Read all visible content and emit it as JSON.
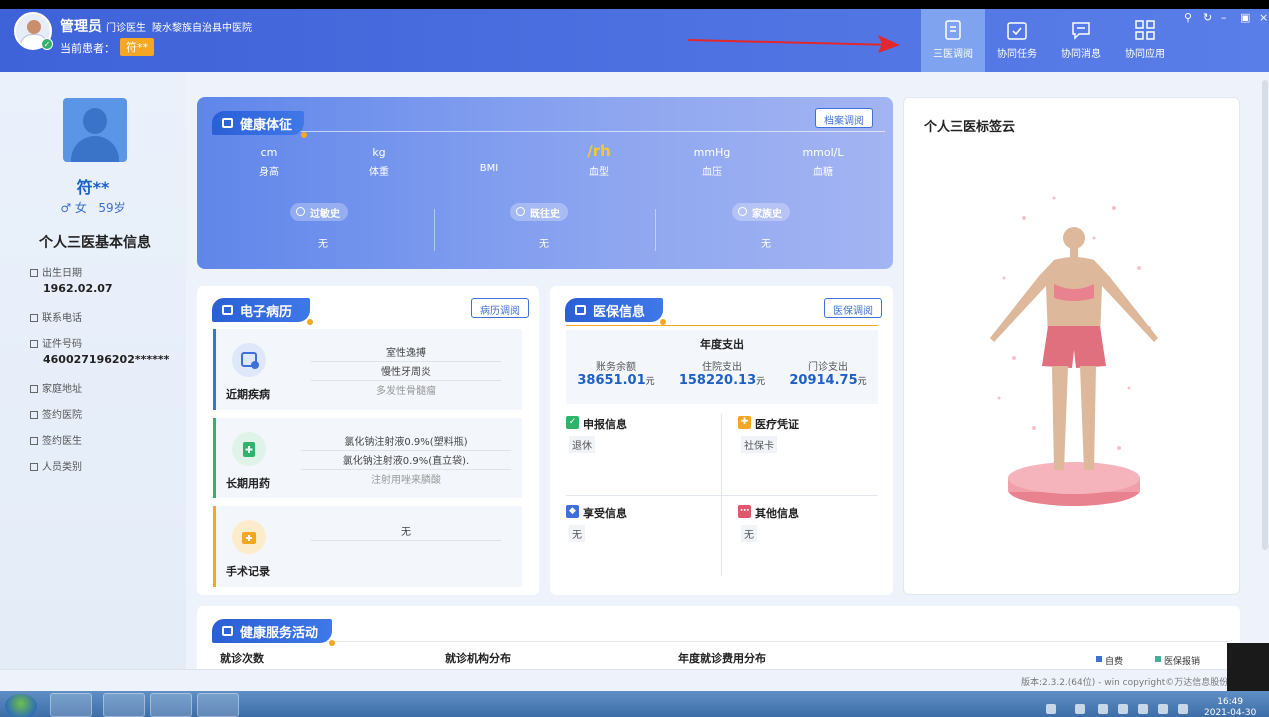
{
  "header": {
    "user_name": "管理员",
    "user_role": "门诊医生",
    "hospital": "陵水黎族自治县中医院",
    "current_patient_label": "当前患者：",
    "current_patient_name": "符**",
    "nav": [
      {
        "label": "三医调阅",
        "icon": "document-icon",
        "active": true
      },
      {
        "label": "协同任务",
        "icon": "calendar-check-icon",
        "active": false
      },
      {
        "label": "协同消息",
        "icon": "chat-icon",
        "active": false
      },
      {
        "label": "协同应用",
        "icon": "apps-grid-icon",
        "active": false
      }
    ],
    "accent_color": "#4a6fe0"
  },
  "patient": {
    "name": "符**",
    "gender": "女",
    "age": "59岁",
    "section_title": "个人三医基本信息",
    "fields": [
      {
        "label": "出生日期",
        "value": "1962.02.07"
      },
      {
        "label": "联系电话",
        "value": ""
      },
      {
        "label": "证件号码",
        "value": "460027196202******"
      },
      {
        "label": "家庭地址",
        "value": ""
      },
      {
        "label": "签约医院",
        "value": ""
      },
      {
        "label": "签约医生",
        "value": ""
      },
      {
        "label": "人员类别",
        "value": ""
      }
    ]
  },
  "health_signs": {
    "title": "健康体征",
    "button": "档案调阅",
    "metrics": [
      {
        "unit": "cm",
        "label": "身高"
      },
      {
        "unit": "kg",
        "label": "体重"
      },
      {
        "unit": "",
        "label": "BMI"
      },
      {
        "unit": "/rh",
        "label": "血型"
      },
      {
        "unit": "mmHg",
        "label": "血压"
      },
      {
        "unit": "mmol/L",
        "label": "血糖"
      }
    ],
    "histories": [
      {
        "label": "过敏史",
        "value": "无"
      },
      {
        "label": "既往史",
        "value": "无"
      },
      {
        "label": "家族史",
        "value": "无"
      }
    ]
  },
  "emr": {
    "title": "电子病历",
    "button": "病历调阅",
    "sections": [
      {
        "caption": "近期疾病",
        "lines": [
          "室性逸搏",
          "慢性牙周炎",
          "多发性骨髓瘤"
        ]
      },
      {
        "caption": "长期用药",
        "lines": [
          "氯化钠注射液0.9%(塑料瓶)",
          "氯化钠注射液0.9%(直立袋).",
          "注射用唑来膦酸"
        ]
      },
      {
        "caption": "手术记录",
        "lines": [
          "无"
        ]
      }
    ]
  },
  "insurance": {
    "title": "医保信息",
    "button": "医保调阅",
    "annual_title": "年度支出",
    "annual": [
      {
        "label": "账务余额",
        "value": "38651.01",
        "unit": "元"
      },
      {
        "label": "住院支出",
        "value": "158220.13",
        "unit": "元"
      },
      {
        "label": "门诊支出",
        "value": "20914.75",
        "unit": "元"
      }
    ],
    "items": [
      {
        "label": "申报信息",
        "value": "退休",
        "color": "#2fb36b"
      },
      {
        "label": "医疗凭证",
        "value": "社保卡",
        "color": "#f5a623"
      },
      {
        "label": "享受信息",
        "value": "无",
        "color": "#3f6fd8"
      },
      {
        "label": "其他信息",
        "value": "无",
        "color": "#e0566a"
      }
    ]
  },
  "model_panel": {
    "title": "个人三医标签云"
  },
  "services": {
    "title": "健康服务活动",
    "columns": [
      "就诊次数",
      "就诊机构分布",
      "年度就诊费用分布"
    ],
    "legend": [
      {
        "label": "自费",
        "color": "#3f6fd8"
      },
      {
        "label": "医保报销",
        "color": "#3fb39a"
      }
    ]
  },
  "status_bar": {
    "version": "版本:2.3.2.(64位) - win   copyright©万达信息股份"
  },
  "taskbar": {
    "time": "16:49",
    "date": "2021-04-30"
  }
}
